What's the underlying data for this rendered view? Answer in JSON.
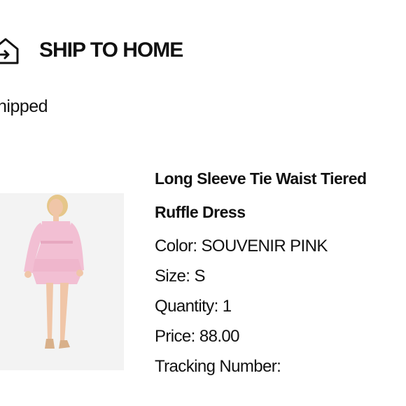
{
  "header": {
    "title": "SHIP TO HOME",
    "icon": "home-shipping-icon"
  },
  "shipment": {
    "status": "hipped"
  },
  "product": {
    "name_line1": "Long Sleeve Tie Waist Tiered",
    "name_line2": "Ruffle Dress",
    "image_icon": "pink-ruffle-dress-photo",
    "color_label": "Color: ",
    "color_value": "SOUVENIR PINK",
    "size_label": "Size: ",
    "size_value": "S",
    "quantity_label": "Quantity: ",
    "quantity_value": "1",
    "price_label": "Price: ",
    "price_value": "88.00",
    "tracking_label": "Tracking Number:",
    "tracking_value": ""
  },
  "colors": {
    "dress": "#f2bfd3",
    "dress_shadow": "#e7a8c0",
    "skin": "#f0c6a8",
    "hair": "#e6c68a"
  }
}
